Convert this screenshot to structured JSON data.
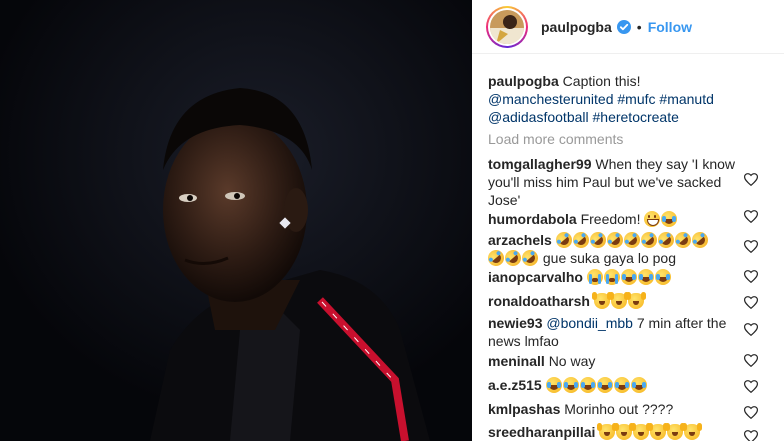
{
  "post": {
    "username": "paulpogba",
    "separator": "•",
    "follow_label": "Follow",
    "verified_icon": "verified-badge-icon"
  },
  "caption": {
    "username": "paulpogba",
    "text": "Caption this!",
    "tags_line1": "@manchesterunited #mufc #manutd",
    "tags_line2": "@adidasfootball #heretocreate"
  },
  "load_more_label": "Load more comments",
  "comments": [
    {
      "username": "tomgallagher99",
      "text": "When they say 'I know you'll miss him Paul but we've sacked Jose'",
      "emoji": []
    },
    {
      "username": "humordabola",
      "text": "Freedom!",
      "emoji": [
        "grin",
        "joy"
      ]
    },
    {
      "username": "arzachels",
      "text": "gue suka gaya lo pog",
      "emoji_before_line1": [
        "rofl",
        "rofl",
        "rofl",
        "rofl",
        "rofl",
        "rofl",
        "rofl",
        "rofl",
        "rofl"
      ],
      "emoji_before_line2": [
        "rofl",
        "rofl",
        "rofl"
      ]
    },
    {
      "username": "ianopcarvalho",
      "text": "",
      "emoji": [
        "sob",
        "sob",
        "joy",
        "joy",
        "joy"
      ]
    },
    {
      "username": "ronaldoatharsh",
      "text": "",
      "emoji": [
        "raise",
        "raise",
        "raise"
      ]
    },
    {
      "username": "newie93",
      "mention": "@bondii_mbb",
      "text": "7 min after the news lmfao",
      "emoji": []
    },
    {
      "username": "meninall",
      "text": "No way",
      "emoji": []
    },
    {
      "username": "a.e.z515",
      "text": "",
      "emoji": [
        "joy",
        "joy",
        "joy",
        "joy",
        "joy",
        "joy"
      ]
    },
    {
      "username": "kmlpashas",
      "text": "Morinho out ????",
      "emoji": []
    },
    {
      "username": "sreedharanpillai",
      "text": "",
      "emoji": [
        "raise",
        "raise",
        "raise",
        "raise",
        "raise",
        "raise"
      ]
    }
  ],
  "colors": {
    "link": "#003569",
    "follow": "#3897f0",
    "muted": "#999999",
    "photo_bg": "#07080c",
    "jacket_stripe": "#c8102e"
  }
}
